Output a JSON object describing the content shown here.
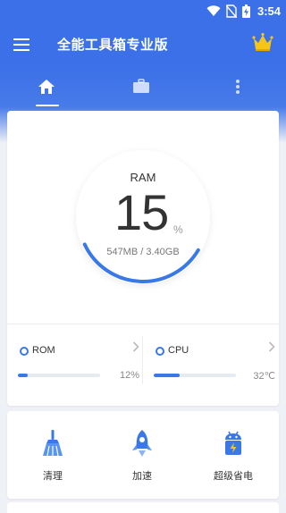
{
  "status_bar": {
    "time": "3:54",
    "icons": [
      "wifi-icon",
      "no-sim-icon",
      "battery-charging-icon"
    ]
  },
  "app_bar": {
    "title": "全能工具箱专业版",
    "menu_icon": "hamburger-menu-icon",
    "crown_icon": "crown-icon"
  },
  "tabs": [
    {
      "name": "home",
      "icon": "home-icon",
      "active": true
    },
    {
      "name": "toolbox",
      "icon": "briefcase-icon",
      "active": false
    },
    {
      "name": "more",
      "icon": "more-vertical-icon",
      "active": false
    }
  ],
  "ram": {
    "label": "RAM",
    "percent": "15",
    "unit": "%",
    "detail": "547MB / 3.40GB",
    "usage_fraction": 0.15
  },
  "stats": [
    {
      "name": "ROM",
      "value": "12%",
      "fill_percent": 12
    },
    {
      "name": "CPU",
      "value": "32℃",
      "fill_percent": 32
    }
  ],
  "tools": [
    {
      "label": "清理",
      "icon": "broom-icon"
    },
    {
      "label": "加速",
      "icon": "rocket-icon"
    },
    {
      "label": "超级省电",
      "icon": "battery-saver-icon"
    }
  ],
  "colors": {
    "primary": "#3b70e8",
    "accent": "#3b78e7",
    "background": "#eef1f6",
    "crown": "#f5c518"
  }
}
